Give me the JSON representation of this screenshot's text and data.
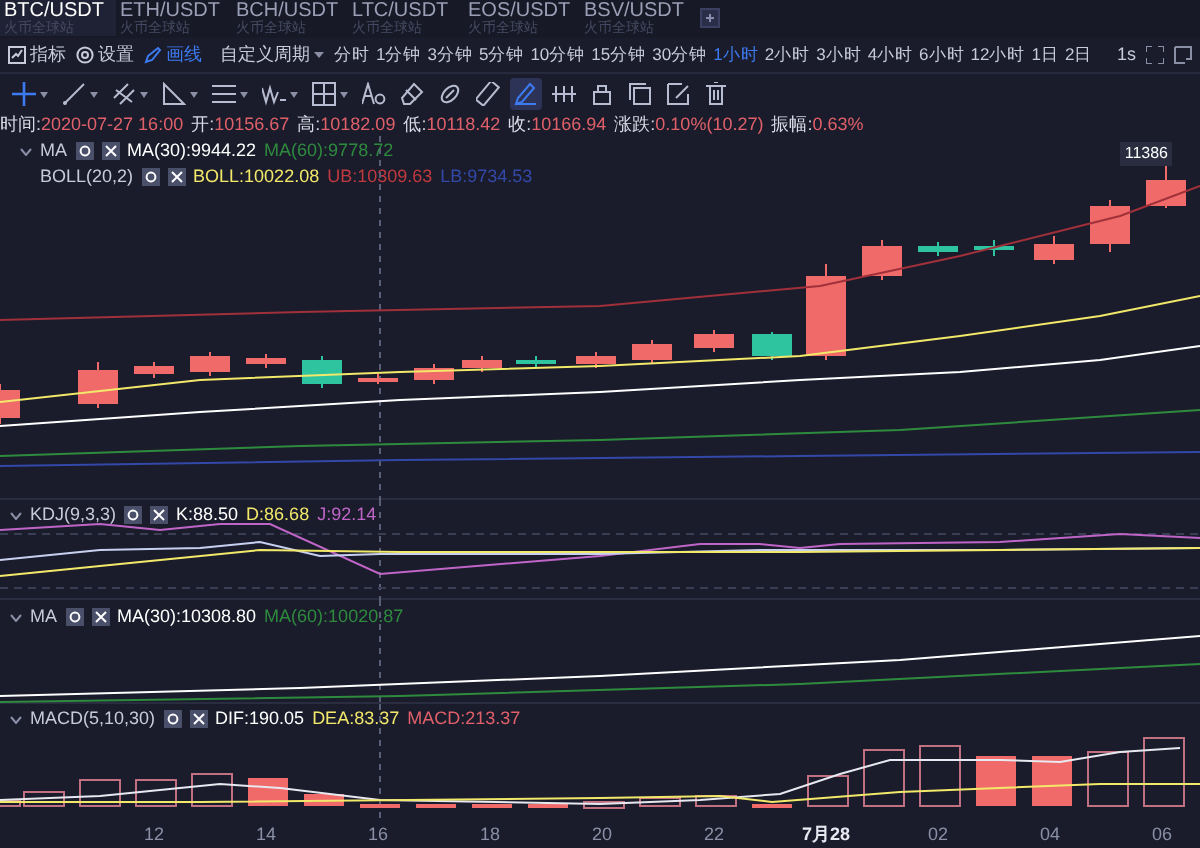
{
  "pair_tabs": [
    {
      "label": "BTC/USDT",
      "sub": "火币全球站",
      "selected": true
    },
    {
      "label": "ETH/USDT",
      "sub": "火币全球站",
      "selected": false
    },
    {
      "label": "BCH/USDT",
      "sub": "火币全球站",
      "selected": false
    },
    {
      "label": "LTC/USDT",
      "sub": "火币全球站",
      "selected": false
    },
    {
      "label": "EOS/USDT",
      "sub": "火币全球站",
      "selected": false
    },
    {
      "label": "BSV/USDT",
      "sub": "火币全球站",
      "selected": false
    }
  ],
  "tool_buttons": [
    {
      "kind": "indicator",
      "label": "指标",
      "selected": false
    },
    {
      "kind": "settings",
      "label": "设置",
      "selected": false
    },
    {
      "kind": "draw",
      "label": "画线",
      "selected": true
    }
  ],
  "period_dropdown": "自定义周期",
  "periods": [
    {
      "label": "分时",
      "selected": false
    },
    {
      "label": "1分钟",
      "selected": false
    },
    {
      "label": "3分钟",
      "selected": false
    },
    {
      "label": "5分钟",
      "selected": false
    },
    {
      "label": "10分钟",
      "selected": false
    },
    {
      "label": "15分钟",
      "selected": false
    },
    {
      "label": "30分钟",
      "selected": false
    },
    {
      "label": "1小时",
      "selected": true
    },
    {
      "label": "2小时",
      "selected": false
    },
    {
      "label": "3小时",
      "selected": false
    },
    {
      "label": "4小时",
      "selected": false
    },
    {
      "label": "6小时",
      "selected": false
    },
    {
      "label": "12小时",
      "selected": false
    },
    {
      "label": "1日",
      "selected": false
    },
    {
      "label": "2日",
      "selected": false
    }
  ],
  "speed": "1s",
  "drawing_tools": [
    {
      "kind": "crosshair",
      "selected": true
    },
    {
      "kind": "line",
      "selected": false
    },
    {
      "kind": "parallel",
      "selected": false
    },
    {
      "kind": "angle",
      "selected": false
    },
    {
      "kind": "hlines",
      "selected": false
    },
    {
      "kind": "wave",
      "selected": false
    },
    {
      "kind": "box",
      "selected": false
    },
    {
      "kind": "text",
      "selected": false
    },
    {
      "kind": "eraser",
      "selected": false
    },
    {
      "kind": "link",
      "selected": false
    },
    {
      "kind": "ruler",
      "selected": false
    },
    {
      "kind": "pen",
      "selected": true
    },
    {
      "kind": "dots",
      "selected": false
    },
    {
      "kind": "lock",
      "selected": false
    },
    {
      "kind": "copy",
      "selected": false
    },
    {
      "kind": "edit",
      "selected": false
    },
    {
      "kind": "trash",
      "selected": false
    }
  ],
  "ohlc": [
    {
      "label": "时间:",
      "value": "2020-07-27 16:00"
    },
    {
      "label": "开:",
      "value": "10156.67"
    },
    {
      "label": "高:",
      "value": "10182.09"
    },
    {
      "label": "低:",
      "value": "10118.42"
    },
    {
      "label": "收:",
      "value": "10166.94"
    },
    {
      "label": "涨跌:",
      "value": "0.10%(10.27)"
    },
    {
      "label": "振幅:",
      "value": "0.63%"
    }
  ],
  "main_indicators": [
    {
      "name": "MA",
      "values": [
        {
          "text": "MA(30):9944.22",
          "color": "#ffffff"
        },
        {
          "text": "MA(60):9778.72",
          "color": "#2e8b3e"
        }
      ]
    },
    {
      "name": "BOLL(20,2)",
      "values": [
        {
          "text": "BOLL:10022.08",
          "color": "#f2e86a"
        },
        {
          "text": "UB:10309.63",
          "color": "#c0393f"
        },
        {
          "text": "LB:9734.53",
          "color": "#3348a8"
        }
      ]
    }
  ],
  "price_label": "11386",
  "kdj": {
    "name": "KDJ(9,3,3)",
    "values": [
      {
        "text": "K:88.50",
        "color": "#ffffff"
      },
      {
        "text": "D:86.68",
        "color": "#f2e86a"
      },
      {
        "text": "J:92.14",
        "color": "#c065c8"
      }
    ]
  },
  "ma": {
    "name": "MA",
    "values": [
      {
        "text": "MA(30):10308.80",
        "color": "#ffffff"
      },
      {
        "text": "MA(60):10020.87",
        "color": "#2e8b3e"
      }
    ]
  },
  "macd": {
    "name": "MACD(5,10,30)",
    "values": [
      {
        "text": "DIF:190.05",
        "color": "#ffffff"
      },
      {
        "text": "DEA:83.37",
        "color": "#f2e86a"
      },
      {
        "text": "MACD:213.37",
        "color": "#e0606a"
      }
    ]
  },
  "x_axis": [
    {
      "label": "12",
      "emphasis": false
    },
    {
      "label": "14",
      "emphasis": false
    },
    {
      "label": "16",
      "emphasis": false
    },
    {
      "label": "18",
      "emphasis": false
    },
    {
      "label": "20",
      "emphasis": false
    },
    {
      "label": "22",
      "emphasis": false
    },
    {
      "label": "7月28",
      "emphasis": true
    },
    {
      "label": "02",
      "emphasis": false
    },
    {
      "label": "04",
      "emphasis": false
    },
    {
      "label": "06",
      "emphasis": false
    }
  ]
}
